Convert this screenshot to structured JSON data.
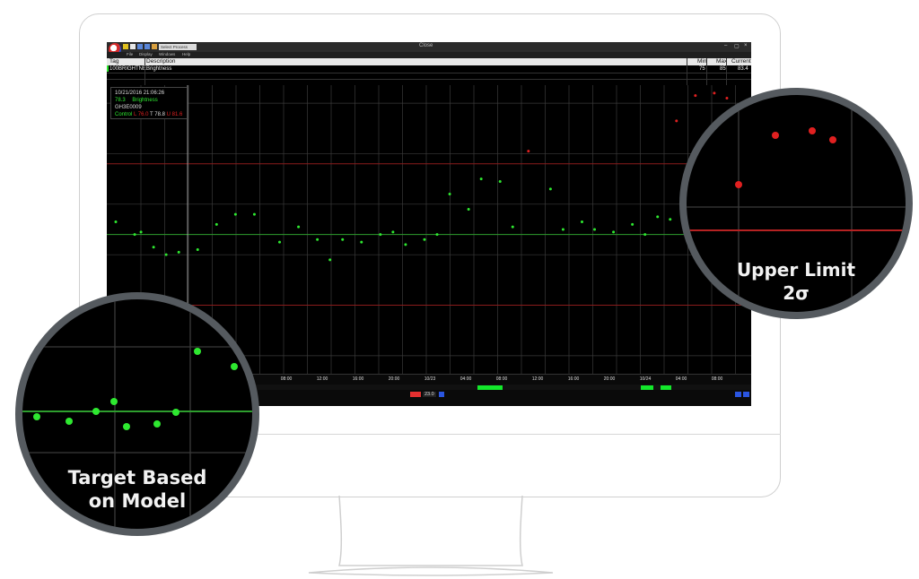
{
  "window": {
    "title": "Close",
    "process_select": "Select Process",
    "menu": [
      "File",
      "Display",
      "Windows",
      "Help"
    ],
    "controls": {
      "minimize": "–",
      "maximize": "▢",
      "close": "×"
    }
  },
  "tag_table": {
    "headers": {
      "tag": "Tag",
      "description": "Description",
      "min": "Min",
      "max": "Max",
      "current": "Current"
    },
    "row": {
      "tag": "100BRIGHTNE",
      "description": "Brightness",
      "min": "75",
      "max": "85",
      "current": "83.4"
    }
  },
  "info_box": {
    "datetime": "10/21/2016 21:06:26",
    "value": "78.3",
    "series": "Brightness",
    "id": "GH3E0009",
    "control_label": "Control",
    "limit_low": "L 76.0",
    "target": "T 78.8",
    "limit_high": "U 81.6"
  },
  "time_axis": [
    "08:00",
    "12:00",
    "16:00",
    "20:00",
    "10/23",
    "04:00",
    "08:00",
    "12:00",
    "16:00",
    "20:00",
    "10/24",
    "04:00",
    "08:00"
  ],
  "zoom": {
    "value": "23.0"
  },
  "callouts": {
    "upper": {
      "line1": "Upper Limit",
      "line2": "2σ"
    },
    "target": {
      "line1": "Target Based",
      "line2": "on Model"
    }
  },
  "colors": {
    "in_control": "#2ee830",
    "out_of_control": "#e02020",
    "target_line": "#2e9e2e",
    "limit_line": "#8a1c1c",
    "grid": "#3a3a3a",
    "lens_ring": "#555a5f"
  },
  "chart_data": {
    "type": "scatter",
    "title": "",
    "xlabel": "",
    "ylabel": "",
    "ylim": [
      73.5,
      84.5
    ],
    "target": 78.8,
    "upper_limit": 81.6,
    "lower_limit": 76.0,
    "grid": true,
    "series": [
      {
        "name": "Brightness",
        "points": [
          {
            "x": 0.0,
            "y": 79.3,
            "status": "in"
          },
          {
            "x": 0.03,
            "y": 78.8,
            "status": "in"
          },
          {
            "x": 0.04,
            "y": 78.9,
            "status": "in"
          },
          {
            "x": 0.06,
            "y": 78.3,
            "status": "in"
          },
          {
            "x": 0.08,
            "y": 78.0,
            "status": "in"
          },
          {
            "x": 0.1,
            "y": 78.1,
            "status": "in"
          },
          {
            "x": 0.13,
            "y": 78.2,
            "status": "in"
          },
          {
            "x": 0.16,
            "y": 79.2,
            "status": "in"
          },
          {
            "x": 0.19,
            "y": 79.6,
            "status": "in"
          },
          {
            "x": 0.22,
            "y": 79.6,
            "status": "in"
          },
          {
            "x": 0.26,
            "y": 78.5,
            "status": "in"
          },
          {
            "x": 0.29,
            "y": 79.1,
            "status": "in"
          },
          {
            "x": 0.32,
            "y": 78.6,
            "status": "in"
          },
          {
            "x": 0.34,
            "y": 77.8,
            "status": "in"
          },
          {
            "x": 0.36,
            "y": 78.6,
            "status": "in"
          },
          {
            "x": 0.39,
            "y": 78.5,
            "status": "in"
          },
          {
            "x": 0.42,
            "y": 78.8,
            "status": "in"
          },
          {
            "x": 0.44,
            "y": 78.9,
            "status": "in"
          },
          {
            "x": 0.46,
            "y": 78.4,
            "status": "in"
          },
          {
            "x": 0.49,
            "y": 78.6,
            "status": "in"
          },
          {
            "x": 0.51,
            "y": 78.8,
            "status": "in"
          },
          {
            "x": 0.53,
            "y": 80.4,
            "status": "in"
          },
          {
            "x": 0.56,
            "y": 79.8,
            "status": "in"
          },
          {
            "x": 0.58,
            "y": 81.0,
            "status": "in"
          },
          {
            "x": 0.61,
            "y": 80.9,
            "status": "in"
          },
          {
            "x": 0.63,
            "y": 79.1,
            "status": "in"
          },
          {
            "x": 0.655,
            "y": 82.1,
            "status": "out"
          },
          {
            "x": 0.69,
            "y": 80.6,
            "status": "in"
          },
          {
            "x": 0.71,
            "y": 79.0,
            "status": "in"
          },
          {
            "x": 0.74,
            "y": 79.3,
            "status": "in"
          },
          {
            "x": 0.76,
            "y": 79.0,
            "status": "in"
          },
          {
            "x": 0.79,
            "y": 78.9,
            "status": "in"
          },
          {
            "x": 0.82,
            "y": 79.2,
            "status": "in"
          },
          {
            "x": 0.84,
            "y": 78.8,
            "status": "in"
          },
          {
            "x": 0.86,
            "y": 79.5,
            "status": "in"
          },
          {
            "x": 0.88,
            "y": 79.4,
            "status": "in"
          },
          {
            "x": 0.89,
            "y": 83.3,
            "status": "out"
          },
          {
            "x": 0.91,
            "y": 79.2,
            "status": "in"
          },
          {
            "x": 0.92,
            "y": 84.3,
            "status": "out"
          },
          {
            "x": 0.94,
            "y": 79.1,
            "status": "in"
          },
          {
            "x": 0.95,
            "y": 84.4,
            "status": "out"
          },
          {
            "x": 0.97,
            "y": 84.2,
            "status": "out"
          }
        ]
      }
    ]
  }
}
